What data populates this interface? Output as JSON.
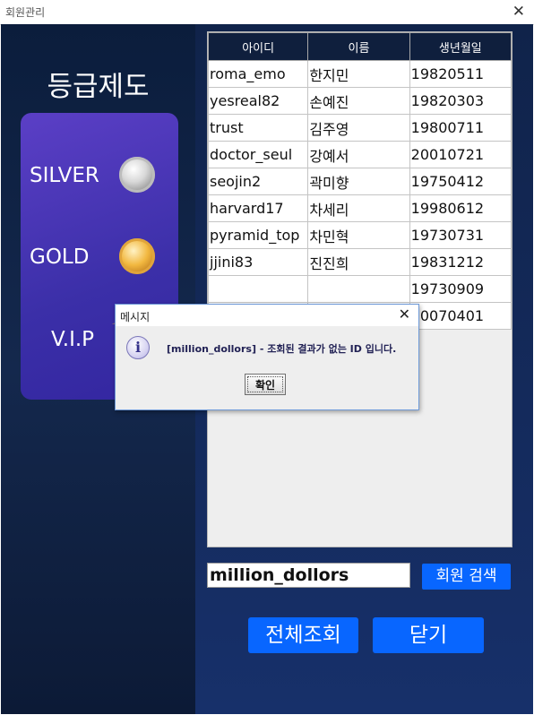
{
  "window": {
    "title": "회원관리",
    "close_icon": "close-icon"
  },
  "grades": {
    "title": "등급제도",
    "items": [
      {
        "label": "SILVER",
        "icon": "silver-medal-icon"
      },
      {
        "label": "GOLD",
        "icon": "gold-medal-icon"
      },
      {
        "label": "V.I.P",
        "icon": "vip-medal-icon"
      }
    ]
  },
  "table": {
    "headers": [
      "아이디",
      "이름",
      "생년월일"
    ],
    "rows": [
      [
        "roma_emo",
        "한지민",
        "19820511"
      ],
      [
        "yesreal82",
        "손예진",
        "19820303"
      ],
      [
        "trust",
        "김주영",
        "19800711"
      ],
      [
        "doctor_seul",
        "강예서",
        "20010721"
      ],
      [
        "seojin2",
        "곽미향",
        "19750412"
      ],
      [
        "harvard17",
        "차세리",
        "19980612"
      ],
      [
        "pyramid_top",
        "차민혁",
        "19730731"
      ],
      [
        "jjini83",
        "진진희",
        "19831212"
      ],
      [
        "",
        "",
        "19730909"
      ],
      [
        "",
        "",
        "20070401"
      ]
    ]
  },
  "search": {
    "value": "million_dollors",
    "button_label": "회원 검색"
  },
  "buttons": {
    "view_all": "전체조회",
    "close": "닫기"
  },
  "dialog": {
    "title": "메시지",
    "message": "[million_dollors] - 조회된 결과가 없는 ID 입니다.",
    "ok_label": "확인",
    "icon": "info-icon"
  },
  "colors": {
    "accent_button": "#0866ff",
    "panel_bg": "#10234a",
    "grade_card": "#4a35b5"
  }
}
